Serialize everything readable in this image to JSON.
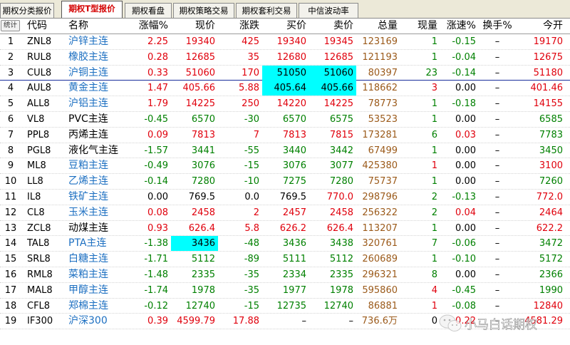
{
  "tabs": [
    {
      "label": "期权分类报价",
      "active": false
    },
    {
      "label": "期权T型报价",
      "active": true
    },
    {
      "label": "期权看盘",
      "active": false
    },
    {
      "label": "期权策略交易",
      "active": false
    },
    {
      "label": "期权套利交易",
      "active": false
    },
    {
      "label": "中信波动率",
      "active": false
    }
  ],
  "table": {
    "seq_header": "统计",
    "headers": {
      "code": "代码",
      "name": "名称",
      "change_pct": "涨幅%",
      "price": "现价",
      "change": "涨跌",
      "bid": "买价",
      "ask": "卖价",
      "volume": "总量",
      "last_vol": "现量",
      "speed": "涨速%",
      "turnover": "换手%",
      "open": "今开"
    },
    "rows": [
      {
        "seq": "1",
        "code": "ZNL8",
        "name": "沪锌主连",
        "name_color": "blue",
        "change_pct": "2.25",
        "price": "19340",
        "change": "425",
        "bid": "19340",
        "ask": "19345",
        "volume": "123169",
        "last_vol": "1",
        "speed": "-0.15",
        "turnover": "–",
        "open": "19170",
        "dir": "up",
        "last_vol_color": "green",
        "speed_color": "green",
        "open_color": "red"
      },
      {
        "seq": "2",
        "code": "RUL8",
        "name": "橡胶主连",
        "name_color": "blue",
        "change_pct": "0.28",
        "price": "12685",
        "change": "35",
        "bid": "12680",
        "ask": "12685",
        "volume": "121193",
        "last_vol": "1",
        "speed": "-0.04",
        "turnover": "–",
        "open": "12675",
        "dir": "up",
        "last_vol_color": "green",
        "speed_color": "green",
        "open_color": "red"
      },
      {
        "seq": "3",
        "code": "CUL8",
        "name": "沪铜主连",
        "name_color": "blue",
        "change_pct": "0.33",
        "price": "51060",
        "change": "170",
        "bid": "51050",
        "ask": "51060",
        "volume": "80397",
        "last_vol": "23",
        "speed": "-0.14",
        "turnover": "–",
        "open": "51180",
        "dir": "up",
        "last_vol_color": "green",
        "speed_color": "green",
        "open_color": "red",
        "hl_bid": true,
        "hl_ask": true,
        "selected": true
      },
      {
        "seq": "4",
        "code": "AUL8",
        "name": "黄金主连",
        "name_color": "blue",
        "change_pct": "1.47",
        "price": "405.66",
        "change": "5.88",
        "bid": "405.64",
        "ask": "405.66",
        "volume": "118662",
        "last_vol": "3",
        "speed": "0.00",
        "turnover": "–",
        "open": "401.46",
        "dir": "up",
        "last_vol_color": "red",
        "speed_color": "black",
        "open_color": "red",
        "hl_bid": true,
        "hl_ask": true
      },
      {
        "seq": "5",
        "code": "ALL8",
        "name": "沪铝主连",
        "name_color": "blue",
        "change_pct": "1.79",
        "price": "14225",
        "change": "250",
        "bid": "14220",
        "ask": "14225",
        "volume": "78773",
        "last_vol": "1",
        "speed": "-0.18",
        "turnover": "–",
        "open": "14155",
        "dir": "up",
        "last_vol_color": "green",
        "speed_color": "green",
        "open_color": "red"
      },
      {
        "seq": "6",
        "code": "VL8",
        "name": "PVC主连",
        "name_color": "black",
        "change_pct": "-0.45",
        "price": "6570",
        "change": "-30",
        "bid": "6570",
        "ask": "6575",
        "volume": "53523",
        "last_vol": "1",
        "speed": "0.00",
        "turnover": "–",
        "open": "6585",
        "dir": "down",
        "last_vol_color": "green",
        "speed_color": "black",
        "open_color": "green"
      },
      {
        "seq": "7",
        "code": "PPL8",
        "name": "丙烯主连",
        "name_color": "black",
        "change_pct": "0.09",
        "price": "7813",
        "change": "7",
        "bid": "7813",
        "ask": "7815",
        "volume": "173281",
        "last_vol": "6",
        "speed": "0.03",
        "turnover": "–",
        "open": "7783",
        "dir": "up",
        "last_vol_color": "green",
        "speed_color": "red",
        "open_color": "green"
      },
      {
        "seq": "8",
        "code": "PGL8",
        "name": "液化气主连",
        "name_color": "black",
        "change_pct": "-1.57",
        "price": "3441",
        "change": "-55",
        "bid": "3440",
        "ask": "3442",
        "volume": "67499",
        "last_vol": "1",
        "speed": "0.00",
        "turnover": "–",
        "open": "3450",
        "dir": "down",
        "last_vol_color": "green",
        "speed_color": "black",
        "open_color": "green"
      },
      {
        "seq": "9",
        "code": "ML8",
        "name": "豆粕主连",
        "name_color": "blue",
        "change_pct": "-0.49",
        "price": "3076",
        "change": "-15",
        "bid": "3076",
        "ask": "3077",
        "volume": "425380",
        "last_vol": "1",
        "speed": "0.00",
        "turnover": "–",
        "open": "3100",
        "dir": "down",
        "last_vol_color": "red",
        "speed_color": "black",
        "open_color": "red"
      },
      {
        "seq": "10",
        "code": "LL8",
        "name": "乙烯主连",
        "name_color": "blue",
        "change_pct": "-0.14",
        "price": "7280",
        "change": "-10",
        "bid": "7275",
        "ask": "7280",
        "volume": "75737",
        "last_vol": "1",
        "speed": "0.00",
        "turnover": "–",
        "open": "7260",
        "dir": "down",
        "last_vol_color": "green",
        "speed_color": "black",
        "open_color": "green"
      },
      {
        "seq": "11",
        "code": "IL8",
        "name": "铁矿主连",
        "name_color": "blue",
        "change_pct": "0.00",
        "price": "769.5",
        "change": "0.0",
        "bid": "769.5",
        "ask": "770.0",
        "volume": "298796",
        "last_vol": "2",
        "speed": "-0.13",
        "turnover": "–",
        "open": "772.0",
        "dir": "flat",
        "ask_color": "red",
        "last_vol_color": "green",
        "speed_color": "green",
        "open_color": "red"
      },
      {
        "seq": "12",
        "code": "CL8",
        "name": "玉米主连",
        "name_color": "blue",
        "change_pct": "0.08",
        "price": "2458",
        "change": "2",
        "bid": "2457",
        "ask": "2458",
        "volume": "256322",
        "last_vol": "2",
        "speed": "0.04",
        "turnover": "–",
        "open": "2464",
        "dir": "up",
        "last_vol_color": "green",
        "speed_color": "red",
        "open_color": "red"
      },
      {
        "seq": "13",
        "code": "ZCL8",
        "name": "动煤主连",
        "name_color": "black",
        "change_pct": "0.93",
        "price": "626.4",
        "change": "5.8",
        "bid": "626.2",
        "ask": "626.4",
        "volume": "113207",
        "last_vol": "1",
        "speed": "0.00",
        "turnover": "–",
        "open": "622.2",
        "dir": "up",
        "last_vol_color": "green",
        "speed_color": "black",
        "open_color": "red"
      },
      {
        "seq": "14",
        "code": "TAL8",
        "name": "PTA主连",
        "name_color": "blue",
        "change_pct": "-1.38",
        "price": "3436",
        "change": "-48",
        "bid": "3436",
        "ask": "3438",
        "volume": "320761",
        "last_vol": "7",
        "speed": "-0.06",
        "turnover": "–",
        "open": "3472",
        "dir": "down",
        "last_vol_color": "green",
        "speed_color": "green",
        "open_color": "green",
        "hl_price": true
      },
      {
        "seq": "15",
        "code": "SRL8",
        "name": "白糖主连",
        "name_color": "blue",
        "change_pct": "-1.71",
        "price": "5112",
        "change": "-89",
        "bid": "5111",
        "ask": "5112",
        "volume": "260689",
        "last_vol": "1",
        "speed": "-0.10",
        "turnover": "–",
        "open": "5172",
        "dir": "down",
        "last_vol_color": "green",
        "speed_color": "green",
        "open_color": "green"
      },
      {
        "seq": "16",
        "code": "RML8",
        "name": "菜粕主连",
        "name_color": "blue",
        "change_pct": "-1.48",
        "price": "2335",
        "change": "-35",
        "bid": "2334",
        "ask": "2335",
        "volume": "296321",
        "last_vol": "8",
        "speed": "0.00",
        "turnover": "–",
        "open": "2366",
        "dir": "down",
        "last_vol_color": "green",
        "speed_color": "black",
        "open_color": "green"
      },
      {
        "seq": "17",
        "code": "MAL8",
        "name": "甲醇主连",
        "name_color": "blue",
        "change_pct": "-1.74",
        "price": "1978",
        "change": "-35",
        "bid": "1977",
        "ask": "1978",
        "volume": "595860",
        "last_vol": "4",
        "speed": "-0.45",
        "turnover": "–",
        "open": "1990",
        "dir": "down",
        "last_vol_color": "red",
        "speed_color": "green",
        "open_color": "green"
      },
      {
        "seq": "18",
        "code": "CFL8",
        "name": "郑棉主连",
        "name_color": "blue",
        "change_pct": "-0.12",
        "price": "12740",
        "change": "-15",
        "bid": "12735",
        "ask": "12740",
        "volume": "86881",
        "last_vol": "1",
        "speed": "-0.08",
        "turnover": "–",
        "open": "12840",
        "dir": "down",
        "last_vol_color": "red",
        "speed_color": "green",
        "open_color": "red"
      },
      {
        "seq": "19",
        "code": "IF300",
        "name": "沪深300",
        "name_color": "blue",
        "change_pct": "0.39",
        "price": "4599.79",
        "change": "17.88",
        "bid": "–",
        "ask": "–",
        "volume": "736.6万",
        "last_vol": "0",
        "speed": "0.22",
        "turnover": "–",
        "open": "4581.29",
        "dir": "up",
        "bid_color": "black",
        "ask_color": "black",
        "last_vol_color": "black",
        "speed_color": "red",
        "open_color": "red"
      }
    ]
  },
  "watermark": {
    "text": "小马白话期权",
    "icon": "wechat-icon"
  },
  "colors": {
    "up": "#e0000c",
    "down": "#008000",
    "flat": "#000000",
    "volume": "#9b5a1a",
    "name_blue": "#1c6fc1",
    "highlight": "#00ffff",
    "active_tab": "#d40000"
  }
}
